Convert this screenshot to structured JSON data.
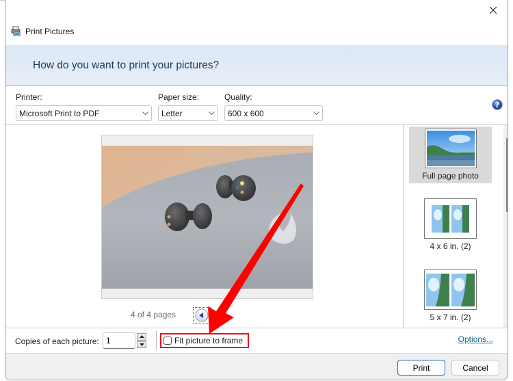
{
  "window": {
    "title": "Print Pictures",
    "close_label": "Close"
  },
  "header": {
    "prompt": "How do you want to print your pictures?"
  },
  "options": {
    "printer": {
      "label": "Printer:",
      "value": "Microsoft Print to PDF"
    },
    "paper_size": {
      "label": "Paper size:",
      "value": "Letter"
    },
    "quality": {
      "label": "Quality:",
      "value": "600 x 600"
    },
    "help_label": "Help"
  },
  "preview": {
    "page_indicator": "4 of 4 pages",
    "current_page": 4,
    "total_pages": 4,
    "image_description": "Two dark grey wireless earbuds and a clear ear tip on grey felt"
  },
  "layouts": {
    "items": [
      {
        "label": "Full page photo",
        "selected": true
      },
      {
        "label": "4 x 6 in. (2)",
        "selected": false
      },
      {
        "label": "5 x 7 in. (2)",
        "selected": false
      }
    ]
  },
  "bottom": {
    "copies_label": "Copies of each picture:",
    "copies_value": "1",
    "fit_label": "Fit picture to frame",
    "fit_checked": false,
    "options_link": "Options..."
  },
  "footer": {
    "print_label": "Print",
    "cancel_label": "Cancel"
  },
  "annotation": {
    "color": "#ff0000",
    "highlight_target": "Fit picture to frame"
  }
}
